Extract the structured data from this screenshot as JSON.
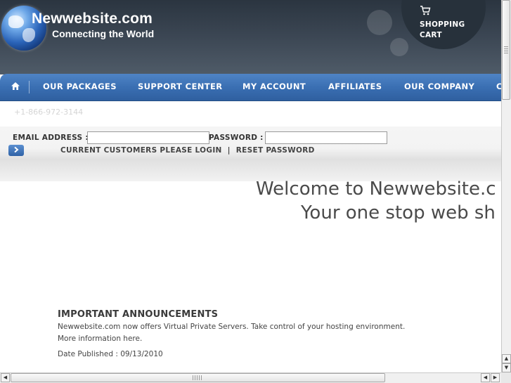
{
  "brand": {
    "name": "Newwebsite.com",
    "tagline": "Connecting the World"
  },
  "cart": {
    "icon": "shopping-cart-icon",
    "label": "SHOPPING CART"
  },
  "nav": {
    "home_icon": "home-icon",
    "items": [
      {
        "label": "OUR PACKAGES"
      },
      {
        "label": "SUPPORT CENTER"
      },
      {
        "label": "MY ACCOUNT"
      },
      {
        "label": "AFFILIATES"
      },
      {
        "label": "OUR COMPANY"
      },
      {
        "label": "C"
      }
    ]
  },
  "contact": {
    "phone": "+1-866-972-3144"
  },
  "login": {
    "email_label": "EMAIL ADDRESS  :",
    "email_value": "",
    "password_label": "PASSWORD  :",
    "password_value": "",
    "submit_icon": "chevron-right-icon",
    "customers_link": "CURRENT CUSTOMERS PLEASE LOGIN",
    "separator": "|",
    "reset_link": "RESET PASSWORD"
  },
  "welcome": {
    "line1": "Welcome to Newwebsite.c",
    "line2": "Your one stop web sh"
  },
  "announcements": {
    "title": "IMPORTANT ANNOUNCEMENTS",
    "text": "Newwebsite.com now offers Virtual Private Servers. Take control of your hosting environment.",
    "more": "More information here.",
    "date": "Date Published : 09/13/2010"
  },
  "colors": {
    "header_dark": "#2b3540",
    "nav_blue": "#3a6fb3",
    "text_dark": "#4a4a4a"
  }
}
